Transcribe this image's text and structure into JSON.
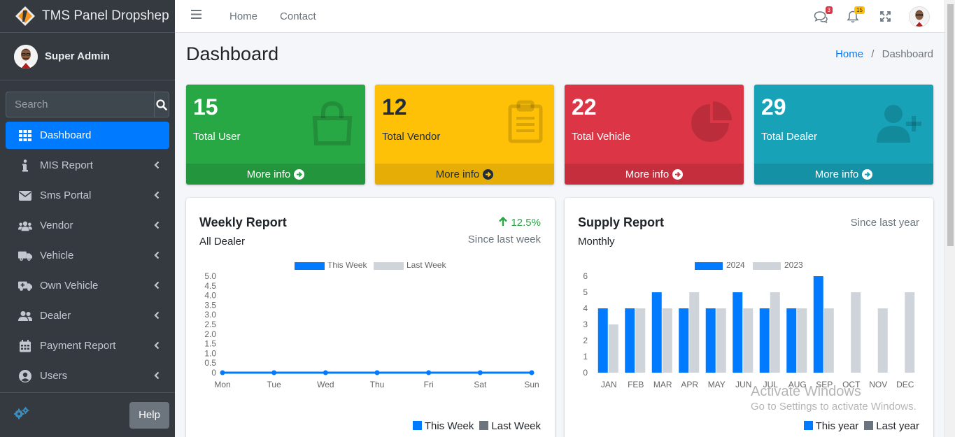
{
  "brand": {
    "name_light": "TMS Panel ",
    "name_bold": "Dropshep"
  },
  "user": {
    "name": "Super Admin"
  },
  "search": {
    "placeholder": "Search"
  },
  "sidebar": {
    "items": [
      {
        "label": "Dashboard",
        "icon": "grid-icon"
      },
      {
        "label": "MIS Report",
        "icon": "info-icon"
      },
      {
        "label": "Sms Portal",
        "icon": "envelope-icon"
      },
      {
        "label": "Vendor",
        "icon": "users-icon"
      },
      {
        "label": "Vehicle",
        "icon": "truck-icon"
      },
      {
        "label": "Own Vehicle",
        "icon": "ambulance-icon"
      },
      {
        "label": "Dealer",
        "icon": "user-friends-icon"
      },
      {
        "label": "Payment Report",
        "icon": "calendar-icon"
      },
      {
        "label": "Users",
        "icon": "user-circle-icon"
      }
    ],
    "help_label": "Help"
  },
  "topnav": {
    "links": [
      "Home",
      "Contact"
    ],
    "messages_badge": "3",
    "notifications_badge": "15"
  },
  "page": {
    "title": "Dashboard",
    "breadcrumb": {
      "home": "Home",
      "sep": "/",
      "current": "Dashboard"
    }
  },
  "stats": [
    {
      "value": "15",
      "label": "Total User",
      "more": "More info",
      "color": "#28a745"
    },
    {
      "value": "12",
      "label": "Total Vendor",
      "more": "More info",
      "color": "#ffc107"
    },
    {
      "value": "22",
      "label": "Total Vehicle",
      "more": "More info",
      "color": "#dc3545"
    },
    {
      "value": "29",
      "label": "Total Dealer",
      "more": "More info",
      "color": "#17a2b8"
    }
  ],
  "weekly": {
    "title": "Weekly Report",
    "subtitle": "All Dealer",
    "change": "12.5%",
    "since": "Since last week",
    "legend_this": "This Week",
    "legend_last": "Last Week"
  },
  "supply": {
    "title": "Supply Report",
    "subtitle": "Monthly",
    "since": "Since last year",
    "legend_this": "This year",
    "legend_last": "Last year"
  },
  "watermark": {
    "line1": "Activate Windows",
    "line2": "Go to Settings to activate Windows."
  },
  "chart_data": [
    {
      "type": "line",
      "title": "Weekly Report",
      "categories": [
        "Mon",
        "Tue",
        "Wed",
        "Thu",
        "Fri",
        "Sat",
        "Sun"
      ],
      "series": [
        {
          "name": "This Week",
          "values": [
            0,
            0,
            0,
            0,
            0,
            0,
            0
          ],
          "color": "#007bff"
        },
        {
          "name": "Last Week",
          "values": [
            0,
            0,
            0,
            0,
            0,
            0,
            0
          ],
          "color": "#ced4da"
        }
      ],
      "ylim": [
        0,
        5
      ],
      "yticks": [
        "0",
        "0.5",
        "1.0",
        "1.5",
        "2.0",
        "2.5",
        "3.0",
        "3.5",
        "4.0",
        "4.5",
        "5.0"
      ],
      "legend": "top"
    },
    {
      "type": "bar",
      "title": "Supply Report",
      "categories": [
        "JAN",
        "FEB",
        "MAR",
        "APR",
        "MAY",
        "JUN",
        "JUL",
        "AUG",
        "SEP",
        "OCT",
        "NOV",
        "DEC"
      ],
      "series": [
        {
          "name": "2024",
          "values": [
            4,
            4,
            5,
            4,
            4,
            5,
            4,
            4,
            6,
            0,
            0,
            0
          ],
          "color": "#007bff"
        },
        {
          "name": "2023",
          "values": [
            3,
            4,
            4,
            5,
            4,
            4,
            5,
            4,
            4,
            5,
            4,
            5
          ],
          "color": "#ced4da"
        }
      ],
      "ylim": [
        0,
        6
      ],
      "yticks": [
        "0",
        "1",
        "2",
        "3",
        "4",
        "5",
        "6"
      ],
      "legend": "top"
    }
  ]
}
